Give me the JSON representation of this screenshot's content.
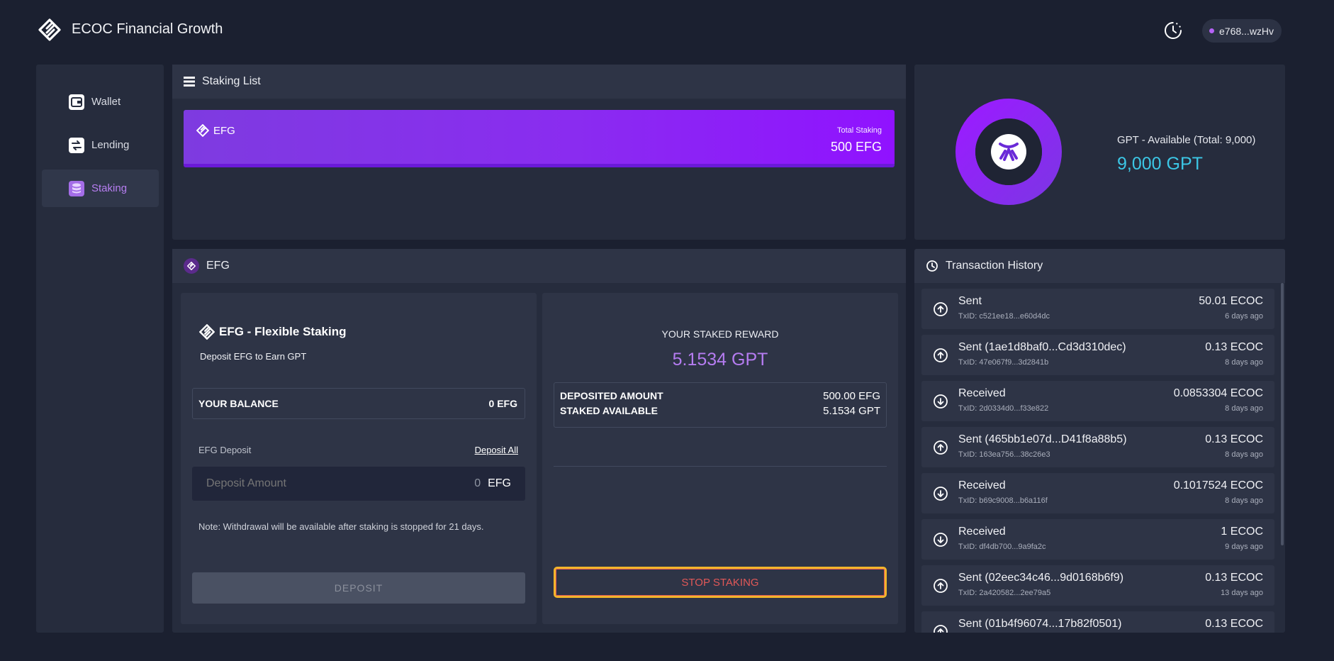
{
  "header": {
    "title": "ECOC Financial Growth",
    "wallet_address": "e768...wzHv",
    "history_icon": "clock-history-icon",
    "logo_icon": "ecoc-logo-icon"
  },
  "colors": {
    "background": "#1b2030",
    "panel": "#262c3d",
    "accent_purple": "#8a2cf0",
    "accent_cyan": "#3cc7e6",
    "stop_text": "#e05858",
    "focus_ring": "#f3b52b"
  },
  "sidebar": {
    "items": [
      {
        "label": "Wallet",
        "icon": "wallet-icon",
        "active": false
      },
      {
        "label": "Lending",
        "icon": "exchange-icon",
        "active": false
      },
      {
        "label": "Staking",
        "icon": "database-icon",
        "active": true
      }
    ]
  },
  "staking_list": {
    "title": "Staking List",
    "card": {
      "symbol": "EFG",
      "total_label": "Total Staking",
      "total_value": "500 EFG"
    }
  },
  "gpt_summary": {
    "label": "GPT - Available (Total: 9,000)",
    "value": "9,000 GPT",
    "available_fraction": 1.0
  },
  "efg_panel": {
    "title": "EFG",
    "left": {
      "title": "EFG - Flexible Staking",
      "subtitle": "Deposit EFG to Earn GPT",
      "balance_label": "YOUR BALANCE",
      "balance_value": "0 EFG",
      "deposit_label": "EFG Deposit",
      "deposit_all": "Deposit All",
      "deposit_placeholder": "Deposit Amount",
      "deposit_value": "0",
      "deposit_unit": "EFG",
      "note": "Note: Withdrawal will be available after staking is stopped for 21 days.",
      "deposit_button": "DEPOSIT"
    },
    "right": {
      "reward_label": "YOUR STAKED REWARD",
      "reward_value": "5.1534 GPT",
      "deposited_label": "DEPOSITED AMOUNT",
      "deposited_value": "500.00 EFG",
      "staked_label": "STAKED AVAILABLE",
      "staked_value": "5.1534 GPT",
      "stop_button": "STOP STAKING"
    }
  },
  "transactions": {
    "title": "Transaction History",
    "items": [
      {
        "type": "sent",
        "title": "Sent",
        "txid": "TxID: c521ee18...e60d4dc",
        "amount": "50.01 ECOC",
        "time": "6 days ago"
      },
      {
        "type": "sent",
        "title": "Sent (1ae1d8baf0...Cd3d310dec)",
        "txid": "TxID: 47e067f9...3d2841b",
        "amount": "0.13 ECOC",
        "time": "8 days ago"
      },
      {
        "type": "received",
        "title": "Received",
        "txid": "TxID: 2d0334d0...f33e822",
        "amount": "0.0853304 ECOC",
        "time": "8 days ago"
      },
      {
        "type": "sent",
        "title": "Sent (465bb1e07d...D41f8a88b5)",
        "txid": "TxID: 163ea756...38c26e3",
        "amount": "0.13 ECOC",
        "time": "8 days ago"
      },
      {
        "type": "received",
        "title": "Received",
        "txid": "TxID: b69c9008...b6a116f",
        "amount": "0.1017524 ECOC",
        "time": "8 days ago"
      },
      {
        "type": "received",
        "title": "Received",
        "txid": "TxID: df4db700...9a9fa2c",
        "amount": "1 ECOC",
        "time": "9 days ago"
      },
      {
        "type": "sent",
        "title": "Sent (02eec34c46...9d0168b6f9)",
        "txid": "TxID: 2a420582...2ee79a5",
        "amount": "0.13 ECOC",
        "time": "13 days ago"
      },
      {
        "type": "sent",
        "title": "Sent (01b4f96074...17b82f0501)",
        "txid": "",
        "amount": "0.13 ECOC",
        "time": ""
      }
    ]
  }
}
